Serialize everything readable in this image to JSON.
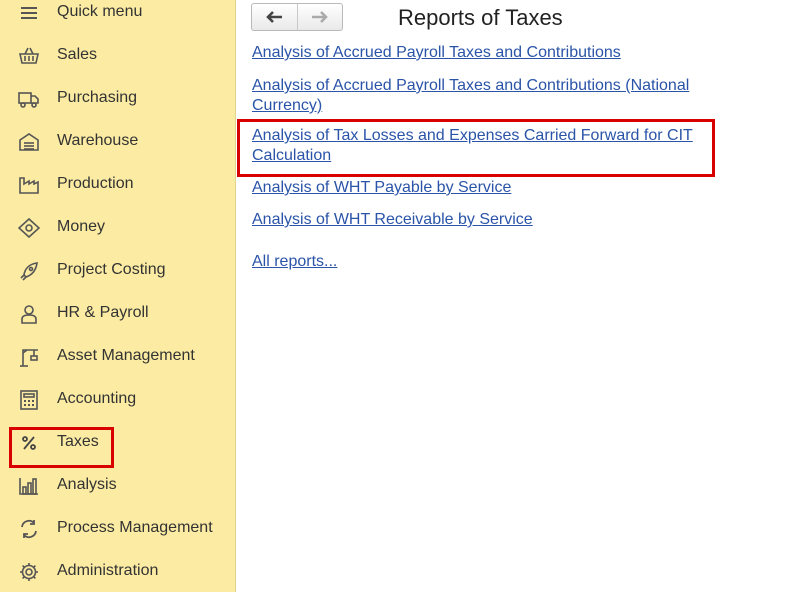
{
  "sidebar": {
    "items": [
      {
        "label": "Quick menu",
        "icon": "hamburger-menu-icon"
      },
      {
        "label": "Sales",
        "icon": "basket-icon"
      },
      {
        "label": "Purchasing",
        "icon": "truck-icon"
      },
      {
        "label": "Warehouse",
        "icon": "warehouse-icon"
      },
      {
        "label": "Production",
        "icon": "factory-icon"
      },
      {
        "label": "Money",
        "icon": "banknote-icon"
      },
      {
        "label": "Project Costing",
        "icon": "rocket-icon"
      },
      {
        "label": "HR & Payroll",
        "icon": "person-icon"
      },
      {
        "label": "Asset Management",
        "icon": "crane-icon"
      },
      {
        "label": "Accounting",
        "icon": "calculator-icon"
      },
      {
        "label": "Taxes",
        "icon": "percent-icon"
      },
      {
        "label": "Analysis",
        "icon": "bar-chart-icon"
      },
      {
        "label": "Process Management",
        "icon": "cycle-arrows-icon"
      },
      {
        "label": "Administration",
        "icon": "gear-icon"
      }
    ],
    "selected": "Taxes"
  },
  "main": {
    "title": "Reports of Taxes",
    "reports": [
      "Analysis of Accrued Payroll Taxes and Contributions",
      "Analysis of Accrued Payroll Taxes and Contributions (National Currency)",
      "Analysis of Tax Losses and Expenses Carried Forward for CIT Calculation",
      "Analysis of WHT Payable by Service",
      "Analysis of WHT Receivable by Service"
    ],
    "all_reports": "All reports..."
  },
  "colors": {
    "sidebar_bg": "#fbeba3",
    "link": "#2a54a8",
    "highlight": "#d90000"
  }
}
